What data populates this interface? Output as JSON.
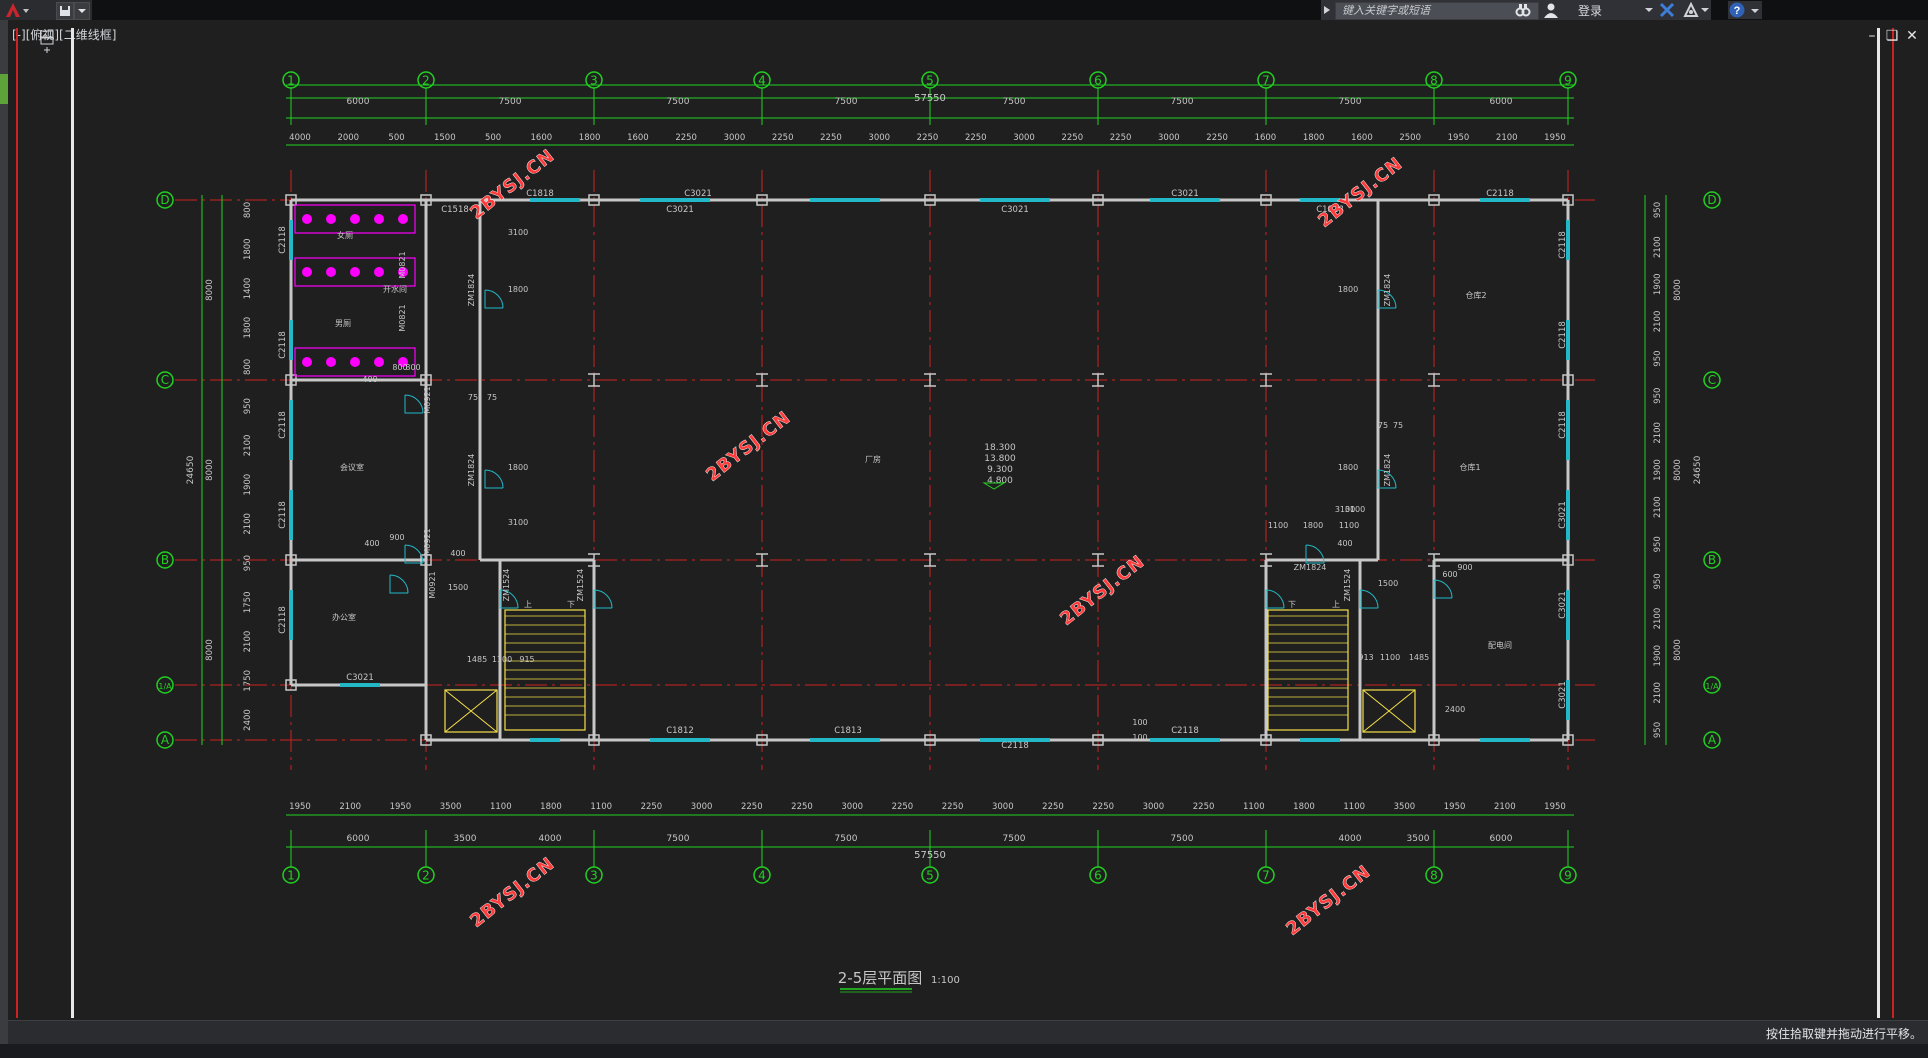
{
  "app": {
    "search_placeholder": "键入关键字或短语",
    "login_label": "登录",
    "viewport_label": "[-][俯视][二维线框]",
    "status_message": "按住拾取键并拖动进行平移。"
  },
  "drawing": {
    "title": "2-5层平面图",
    "scale": "1:100",
    "colors": {
      "axis": "#22d022",
      "wall": "#c7c7c7",
      "window": "#22b8c8",
      "axis_line": "#cc2222",
      "toilet": "#ff00ff",
      "stair": "#f5e04a"
    },
    "grid_columns": [
      "1",
      "2",
      "3",
      "4",
      "5",
      "6",
      "7",
      "8",
      "9"
    ],
    "grid_rows": [
      "D",
      "C",
      "B",
      "1/A",
      "A"
    ],
    "total_dim": "57550",
    "vertical_total": "24650",
    "top_dims_row1": [
      "6000",
      "7500",
      "7500",
      "7500",
      "7500",
      "7500",
      "7500",
      "6000"
    ],
    "top_dims_row2": [
      "4000",
      "2000",
      "500",
      "1500",
      "500",
      "1600",
      "1800",
      "1600",
      "2250",
      "3000",
      "2250",
      "2250",
      "3000",
      "2250",
      "2250",
      "3000",
      "2250",
      "2250",
      "3000",
      "2250",
      "1600",
      "1800",
      "1600",
      "2500",
      "1950",
      "2100",
      "1950"
    ],
    "bottom_dims_row1": [
      "1950",
      "2100",
      "1950",
      "3500",
      "1100",
      "1800",
      "1100",
      "2250",
      "3000",
      "2250",
      "2250",
      "3000",
      "2250",
      "2250",
      "3000",
      "2250",
      "2250",
      "3000",
      "2250",
      "1100",
      "1800",
      "1100",
      "3500",
      "1950",
      "2100",
      "1950"
    ],
    "bottom_dims_row2": [
      "6000",
      "3500",
      "4000",
      "7500",
      "7500",
      "7500",
      "7500",
      "4000",
      "3500",
      "6000"
    ],
    "left_dims": [
      "800",
      "1800",
      "1400",
      "1800",
      "800",
      "950",
      "2100",
      "1900",
      "2100",
      "950",
      "1750",
      "2100",
      "1750",
      "2400"
    ],
    "left_dims_mid": [
      "8000",
      "8000",
      "8000"
    ],
    "right_dims": [
      "950",
      "2100",
      "1900",
      "2100",
      "950",
      "950",
      "2100",
      "1900",
      "2100",
      "950",
      "950",
      "2100",
      "1900",
      "2100",
      "950"
    ],
    "right_dims_mid": [
      "8000",
      "8000",
      "8000"
    ],
    "window_labels": [
      "C1818",
      "C1518",
      "C3021",
      "C3021",
      "C3021",
      "C3021",
      "C1818",
      "C2118",
      "C2118",
      "C2118",
      "C2118",
      "C2118",
      "C2118",
      "C2118",
      "C2118",
      "C2118",
      "C3021",
      "C3021",
      "C3021",
      "C3021",
      "C1812",
      "C1813",
      "C2118",
      "C2118"
    ],
    "door_labels": [
      "ZM1824",
      "ZM1824",
      "ZM1824",
      "ZM1824",
      "ZM1824",
      "ZM1524",
      "ZM1524",
      "ZM1524",
      "M0821",
      "M0821",
      "M0921",
      "M0921",
      "M0921"
    ],
    "room_labels": [
      "女厕",
      "开水间",
      "男厕",
      "会议室",
      "办公室",
      "厂房",
      "仓库2",
      "仓库1",
      "配电间"
    ],
    "elevations": [
      "18.300",
      "13.800",
      "9.300",
      "4.800"
    ],
    "small_dims": [
      "3100",
      "1800",
      "1800",
      "3100",
      "75",
      "75",
      "400",
      "1500",
      "1485",
      "1100",
      "915",
      "1100",
      "1800",
      "1100",
      "913",
      "1100",
      "1485",
      "900",
      "600",
      "800",
      "800",
      "400",
      "900",
      "400",
      "3100",
      "1800",
      "1800",
      "3100",
      "75",
      "75",
      "2400",
      "100",
      "100",
      "400",
      "1500"
    ],
    "stair_labels": [
      "上",
      "下",
      "下",
      "上"
    ],
    "watermark": "2BYSJ.CN"
  }
}
